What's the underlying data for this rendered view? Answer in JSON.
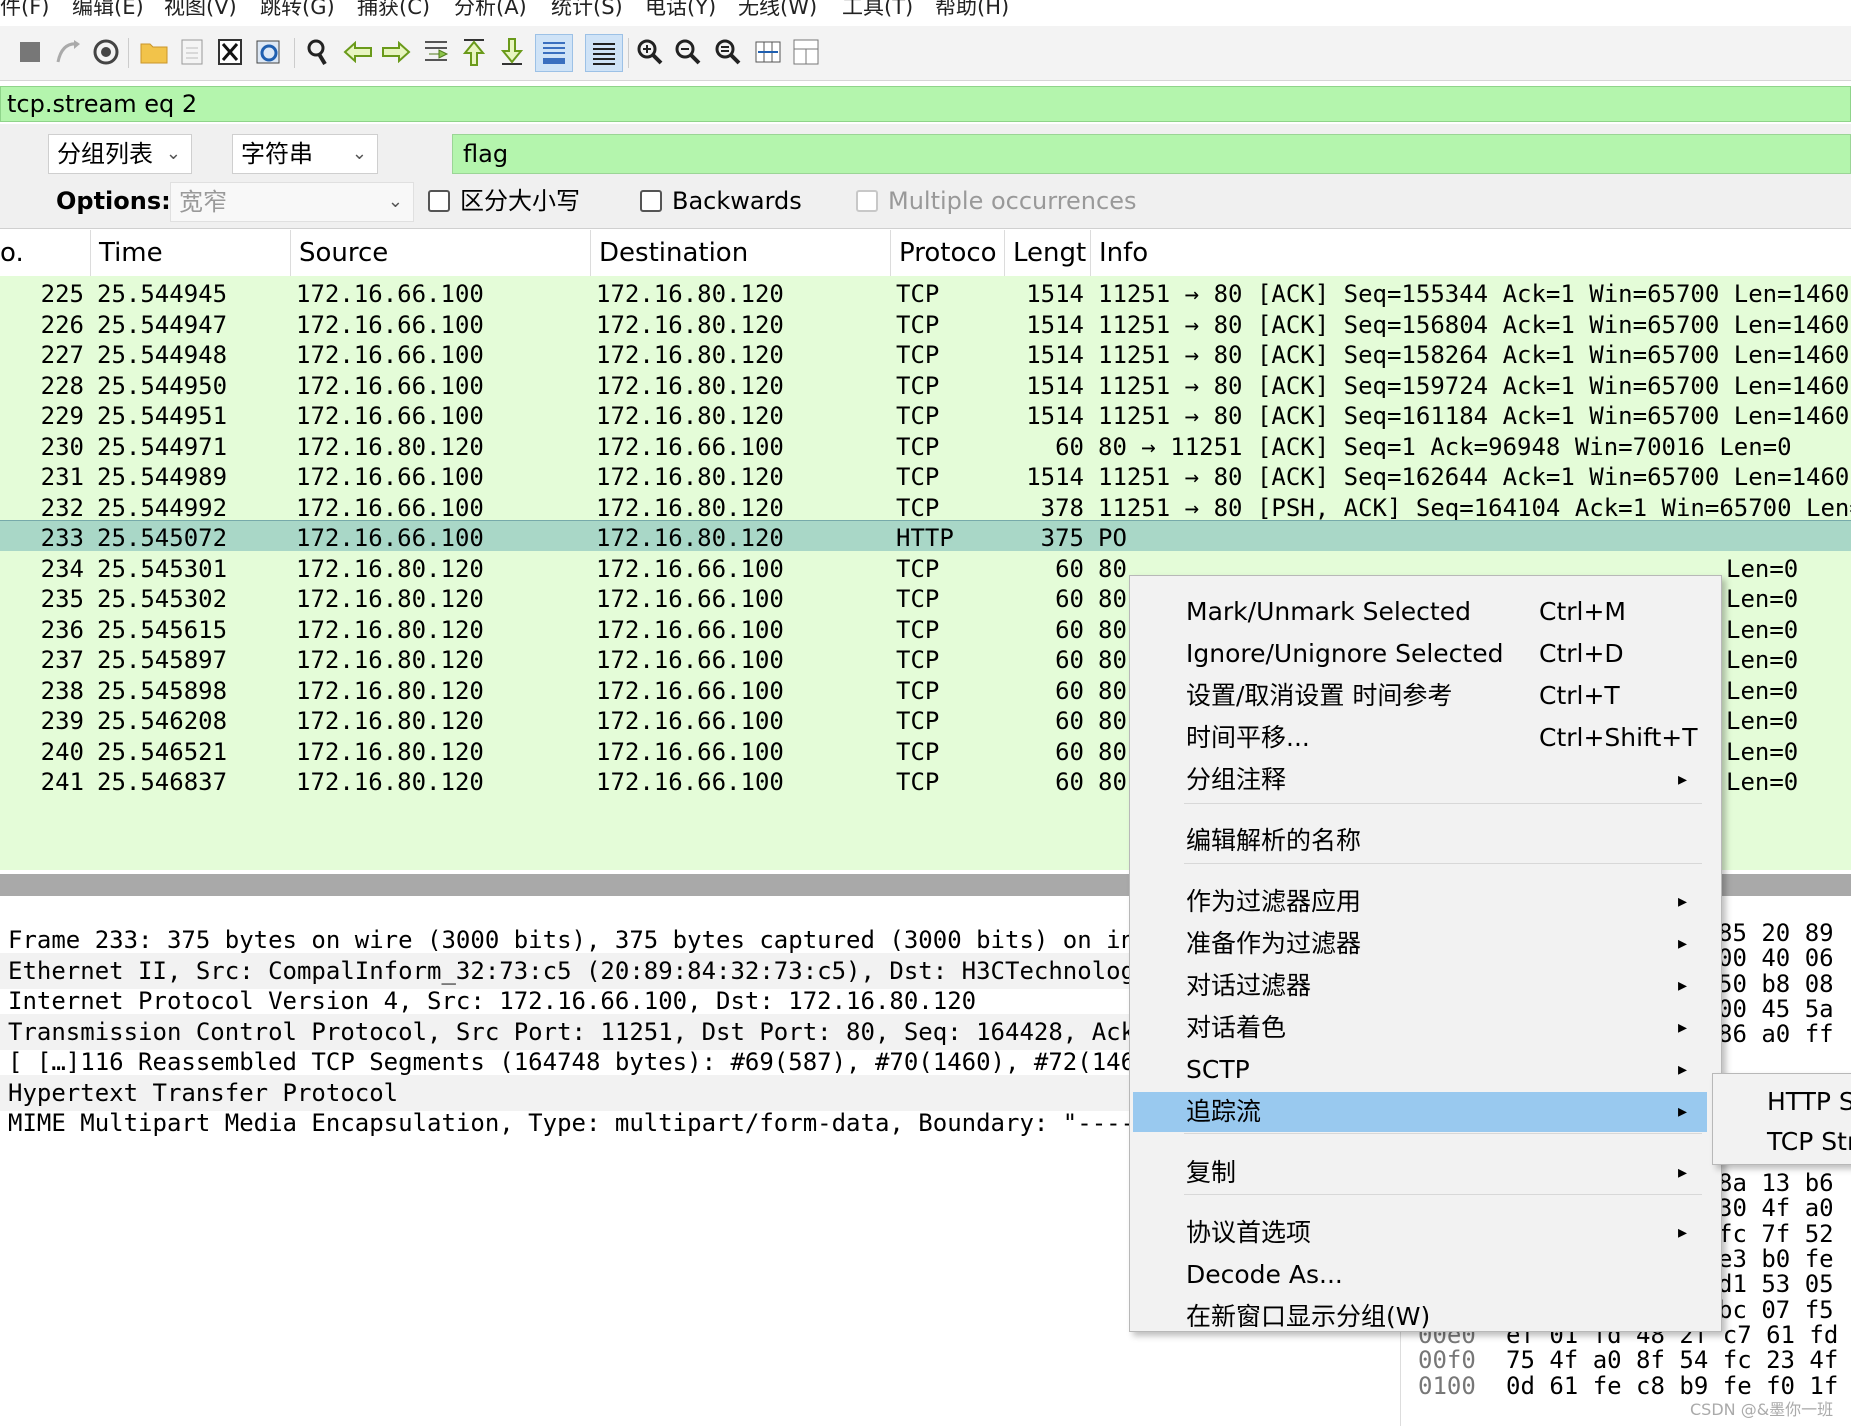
{
  "menubar": [
    "件(F)",
    "编辑(E)",
    "视图(V)",
    "跳转(G)",
    "捕获(C)",
    "分析(A)",
    "统计(S)",
    "电话(Y)",
    "无线(W)",
    "工具(T)",
    "帮助(H)"
  ],
  "display_filter": "tcp.stream eq 2",
  "find": {
    "scope": "分组列表",
    "type": "字符串",
    "query": "flag",
    "options_label": "Options:",
    "charset": "宽窄",
    "case_label": "区分大小写",
    "backwards_label": "Backwards",
    "multiple_label": "Multiple occurrences"
  },
  "columns": [
    "o.",
    "Time",
    "Source",
    "Destination",
    "Protoco",
    "Lengt",
    "Info"
  ],
  "packets": [
    {
      "no": "225",
      "time": "25.544945",
      "src": "172.16.66.100",
      "dst": "172.16.80.120",
      "proto": "TCP",
      "len": "1514",
      "info": "11251 → 80 [ACK] Seq=155344 Ack=1 Win=65700 Len=1460"
    },
    {
      "no": "226",
      "time": "25.544947",
      "src": "172.16.66.100",
      "dst": "172.16.80.120",
      "proto": "TCP",
      "len": "1514",
      "info": "11251 → 80 [ACK] Seq=156804 Ack=1 Win=65700 Len=1460"
    },
    {
      "no": "227",
      "time": "25.544948",
      "src": "172.16.66.100",
      "dst": "172.16.80.120",
      "proto": "TCP",
      "len": "1514",
      "info": "11251 → 80 [ACK] Seq=158264 Ack=1 Win=65700 Len=1460"
    },
    {
      "no": "228",
      "time": "25.544950",
      "src": "172.16.66.100",
      "dst": "172.16.80.120",
      "proto": "TCP",
      "len": "1514",
      "info": "11251 → 80 [ACK] Seq=159724 Ack=1 Win=65700 Len=1460"
    },
    {
      "no": "229",
      "time": "25.544951",
      "src": "172.16.66.100",
      "dst": "172.16.80.120",
      "proto": "TCP",
      "len": "1514",
      "info": "11251 → 80 [ACK] Seq=161184 Ack=1 Win=65700 Len=1460"
    },
    {
      "no": "230",
      "time": "25.544971",
      "src": "172.16.80.120",
      "dst": "172.16.66.100",
      "proto": "TCP",
      "len": "60",
      "info": "80 → 11251 [ACK] Seq=1 Ack=96948 Win=70016 Len=0"
    },
    {
      "no": "231",
      "time": "25.544989",
      "src": "172.16.66.100",
      "dst": "172.16.80.120",
      "proto": "TCP",
      "len": "1514",
      "info": "11251 → 80 [ACK] Seq=162644 Ack=1 Win=65700 Len=1460"
    },
    {
      "no": "232",
      "time": "25.544992",
      "src": "172.16.66.100",
      "dst": "172.16.80.120",
      "proto": "TCP",
      "len": "378",
      "info": "11251 → 80 [PSH, ACK] Seq=164104 Ack=1 Win=65700 Len="
    },
    {
      "no": "233",
      "time": "25.545072",
      "src": "172.16.66.100",
      "dst": "172.16.80.120",
      "proto": "HTTP",
      "len": "375",
      "info": "PO"
    },
    {
      "no": "234",
      "time": "25.545301",
      "src": "172.16.80.120",
      "dst": "172.16.66.100",
      "proto": "TCP",
      "len": "60",
      "info": "80"
    },
    {
      "no": "235",
      "time": "25.545302",
      "src": "172.16.80.120",
      "dst": "172.16.66.100",
      "proto": "TCP",
      "len": "60",
      "info": "80"
    },
    {
      "no": "236",
      "time": "25.545615",
      "src": "172.16.80.120",
      "dst": "172.16.66.100",
      "proto": "TCP",
      "len": "60",
      "info": "80"
    },
    {
      "no": "237",
      "time": "25.545897",
      "src": "172.16.80.120",
      "dst": "172.16.66.100",
      "proto": "TCP",
      "len": "60",
      "info": "80"
    },
    {
      "no": "238",
      "time": "25.545898",
      "src": "172.16.80.120",
      "dst": "172.16.66.100",
      "proto": "TCP",
      "len": "60",
      "info": "80"
    },
    {
      "no": "239",
      "time": "25.546208",
      "src": "172.16.80.120",
      "dst": "172.16.66.100",
      "proto": "TCP",
      "len": "60",
      "info": "80"
    },
    {
      "no": "240",
      "time": "25.546521",
      "src": "172.16.80.120",
      "dst": "172.16.66.100",
      "proto": "TCP",
      "len": "60",
      "info": "80"
    },
    {
      "no": "241",
      "time": "25.546837",
      "src": "172.16.80.120",
      "dst": "172.16.66.100",
      "proto": "TCP",
      "len": "60",
      "info": "80"
    }
  ],
  "selected_packet": "233",
  "info_right": [
    "Len=0",
    "Len=0",
    "Len=0",
    "Len=0",
    "Len=0",
    "Len=0",
    "Len=0",
    "Len=0"
  ],
  "details": [
    "Frame 233: 375 bytes on wire (3000 bits), 375 bytes captured (3000 bits) on in",
    "Ethernet II, Src: CompalInform_32:73:c5 (20:89:84:32:73:c5), Dst: H3CTechnolog",
    "Internet Protocol Version 4, Src: 172.16.66.100, Dst: 172.16.80.120",
    "Transmission Control Protocol, Src Port: 11251, Dst Port: 80, Seq: 164428, Ack",
    "[ […]116 Reassembled TCP Segments (164748 bytes): #69(587), #70(1460), #72(146",
    "Hypertext Transfer Protocol",
    "MIME Multipart Media Encapsulation, Type: multipart/form-data, Boundary: \"----"
  ],
  "bytes_top": [
    "85 20 89",
    "00 40 06",
    "50 b8 08",
    "00 45 5a",
    "86 a0 ff"
  ],
  "bytes_mid": [
    "8a 13 b6",
    "30 4f a0",
    "fc 7f 52",
    "e3 b0 fe",
    "d1 53 05",
    "bc 07 f5"
  ],
  "bytes_bottom": [
    {
      "offset": "00e0",
      "hex": "ef 01 fd 48 2f c7 61 fd"
    },
    {
      "offset": "00f0",
      "hex": "75 4f a0 8f 54 fc 23 4f"
    },
    {
      "offset": "0100",
      "hex": "0d 61 fe c8 b9 fe f0 1f"
    }
  ],
  "context_menu": {
    "items": [
      {
        "label": "Mark/Unmark Selected",
        "shortcut": "Ctrl+M"
      },
      {
        "label": "Ignore/Unignore Selected",
        "shortcut": "Ctrl+D"
      },
      {
        "label": "设置/取消设置 时间参考",
        "shortcut": "Ctrl+T"
      },
      {
        "label": "时间平移...",
        "shortcut": "Ctrl+Shift+T"
      },
      {
        "label": "分组注释",
        "submenu": true
      },
      {
        "label": "编辑解析的名称"
      },
      {
        "label": "作为过滤器应用",
        "submenu": true
      },
      {
        "label": "准备作为过滤器",
        "submenu": true
      },
      {
        "label": "对话过滤器",
        "submenu": true
      },
      {
        "label": "对话着色",
        "submenu": true
      },
      {
        "label": "SCTP",
        "submenu": true
      },
      {
        "label": "追踪流",
        "submenu": true,
        "highlighted": true
      },
      {
        "label": "复制",
        "submenu": true
      },
      {
        "label": "协议首选项",
        "submenu": true
      },
      {
        "label": "Decode As..."
      },
      {
        "label": "在新窗口显示分组(W)"
      }
    ]
  },
  "submenu": [
    "HTTP St",
    "TCP Stre"
  ],
  "watermark": "CSDN @&墨你一班",
  "colors": {
    "filter_ok": "#b4f5ad",
    "row_bg": "#e4fcd8",
    "row_selected": "#a9d7c7",
    "menu_highlight": "#99c9ef"
  }
}
